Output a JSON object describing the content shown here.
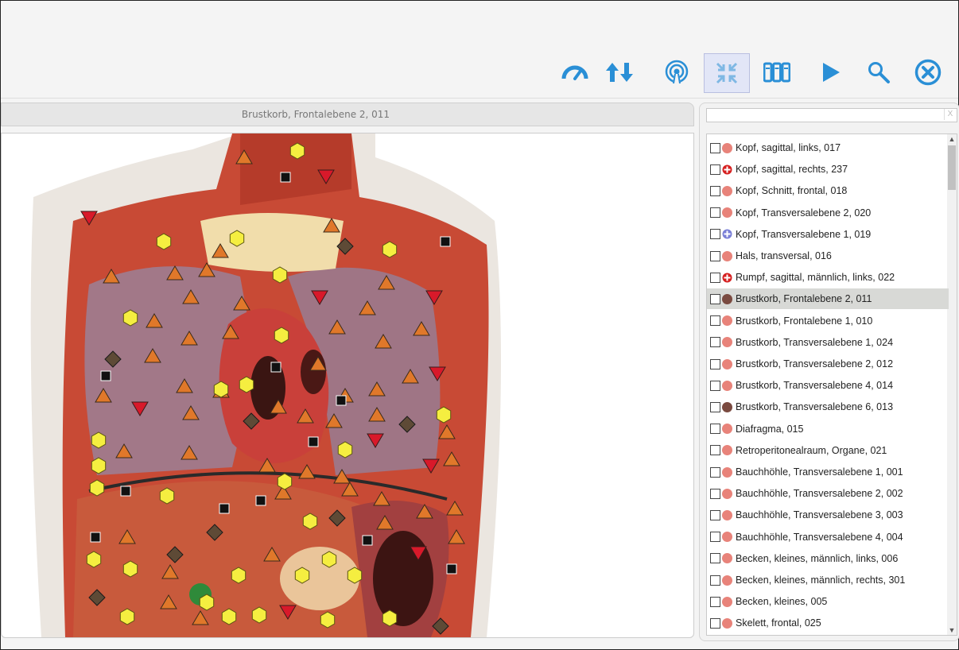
{
  "toolbar": {
    "buttons": [
      {
        "name": "speedometer-icon",
        "color": "#2a8fd6"
      },
      {
        "name": "up-down-arrows-icon",
        "color": "#2a8fd6"
      },
      {
        "name": "broadcast-icon",
        "color": "#2a8fd6"
      },
      {
        "name": "collapse-icon",
        "color": "#7fb8e4",
        "active": true
      },
      {
        "name": "grid-columns-icon",
        "color": "#2a8fd6"
      },
      {
        "name": "play-icon",
        "color": "#2a8fd6"
      },
      {
        "name": "search-icon",
        "color": "#2a8fd6"
      },
      {
        "name": "close-circle-icon",
        "color": "#2a8fd6"
      }
    ]
  },
  "viewer": {
    "title": "Brustkorb, Frontalebene 2,  011"
  },
  "sidebar": {
    "search_value": "",
    "search_clear": "X",
    "items": [
      {
        "label": "Kopf, sagittal, links, 017",
        "marker": "dot",
        "color": "#e8837a"
      },
      {
        "label": "Kopf, sagittal, rechts, 237",
        "marker": "plus",
        "color": "#d62020"
      },
      {
        "label": "Kopf, Schnitt, frontal, 018",
        "marker": "dot",
        "color": "#e8837a"
      },
      {
        "label": "Kopf, Transversalebene 2, 020",
        "marker": "dot",
        "color": "#e8837a"
      },
      {
        "label": "Kopf, Transversalebene 1, 019",
        "marker": "plus",
        "color": "#7a7fd6"
      },
      {
        "label": "Hals, transversal, 016",
        "marker": "dot",
        "color": "#e8837a"
      },
      {
        "label": "Rumpf, sagittal, männlich, links, 022",
        "marker": "plus",
        "color": "#d62020"
      },
      {
        "label": "Brustkorb, Frontalebene 2,  011",
        "marker": "dot",
        "color": "#7a4a40",
        "selected": true
      },
      {
        "label": "Brustkorb, Frontalebene 1, 010",
        "marker": "dot",
        "color": "#e8837a"
      },
      {
        "label": "Brustkorb, Transversalebene 1, 024",
        "marker": "dot",
        "color": "#e8837a"
      },
      {
        "label": "Brustkorb, Transversalebene 2, 012",
        "marker": "dot",
        "color": "#e8837a"
      },
      {
        "label": "Brustkorb, Transversalebene 4, 014",
        "marker": "dot",
        "color": "#e8837a"
      },
      {
        "label": "Brustkorb, Transversalebene 6, 013",
        "marker": "dot",
        "color": "#7a4a40"
      },
      {
        "label": "Diafragma, 015",
        "marker": "dot",
        "color": "#e8837a"
      },
      {
        "label": "Retroperitonealraum, Organe, 021",
        "marker": "dot",
        "color": "#e8837a"
      },
      {
        "label": "Bauchhöhle, Transversalebene 1, 001",
        "marker": "dot",
        "color": "#e8837a"
      },
      {
        "label": "Bauchhöhle, Transversalebene 2, 002",
        "marker": "dot",
        "color": "#e8837a"
      },
      {
        "label": "Bauchhöhle, Transversalebene 3, 003",
        "marker": "dot",
        "color": "#e8837a"
      },
      {
        "label": "Bauchhöhle, Transversalebene 4, 004",
        "marker": "dot",
        "color": "#e8837a"
      },
      {
        "label": "Becken, kleines, männlich, links, 006",
        "marker": "dot",
        "color": "#e8837a"
      },
      {
        "label": "Becken, kleines, männlich, rechts, 301",
        "marker": "dot",
        "color": "#e8837a"
      },
      {
        "label": "Becken, kleines, 005",
        "marker": "dot",
        "color": "#e8837a"
      },
      {
        "label": "Skelett, frontal, 025",
        "marker": "dot",
        "color": "#e8837a"
      }
    ]
  },
  "markers": {
    "colors": {
      "triangle_up": "#e0782a",
      "triangle_down": "#d8192a",
      "hexagon": "#f5ee40",
      "square": "#111111",
      "diamond": "#5e4a36",
      "circle": "#2f8a3a"
    }
  }
}
